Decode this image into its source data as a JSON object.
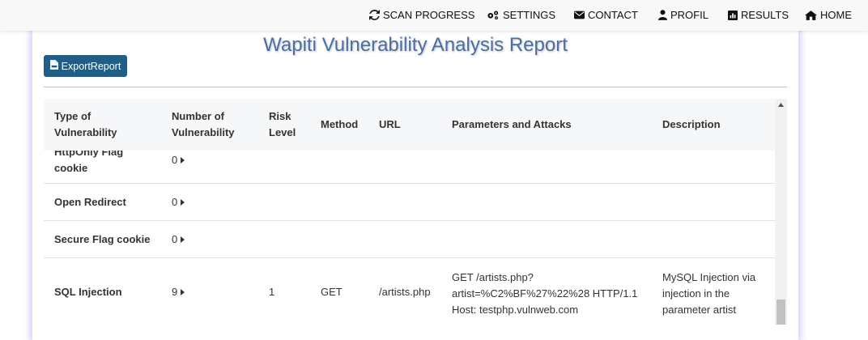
{
  "navbar": {
    "items": [
      {
        "label": "SCAN PROGRESS",
        "icon": "refresh-icon"
      },
      {
        "label": "SETTINGS",
        "icon": "gears-icon"
      },
      {
        "label": "CONTACT",
        "icon": "envelope-icon"
      },
      {
        "label": "PROFIL",
        "icon": "user-icon"
      },
      {
        "label": "RESULTS",
        "icon": "bar-chart-icon"
      },
      {
        "label": "HOME",
        "icon": "home-icon"
      }
    ]
  },
  "report": {
    "title": "Wapiti Vulnerability Analysis Report",
    "export_label": "ExportReport"
  },
  "table": {
    "headers": {
      "type_line1": "Type of",
      "type_line2": "Vulnerability",
      "count_line1": "Number of",
      "count_line2": "Vulnerability",
      "risk_line1": "Risk",
      "risk_line2": "Level",
      "method": "Method",
      "url": "URL",
      "params": "Parameters and Attacks",
      "description": "Description"
    },
    "rows": [
      {
        "type_line1": "HttpOnly Flag",
        "type_line2": "cookie",
        "count": "0"
      },
      {
        "type": "Open Redirect",
        "count": "0"
      },
      {
        "type": "Secure Flag cookie",
        "count": "0"
      },
      {
        "type": "SQL Injection",
        "count": "9",
        "risk": "1",
        "method": "GET",
        "url": "/artists.php",
        "params_line1": "GET /artists.php?",
        "params_line2": "artist=%C2%BF%27%22%28 HTTP/1.1",
        "params_line3": "Host: testphp.vulnweb.com",
        "desc_line1": "MySQL Injection via",
        "desc_line2": "injection in the",
        "desc_line3": "parameter artist"
      }
    ]
  },
  "colors": {
    "title": "#4a6fa5",
    "export_button": "#1f5f86",
    "header_bg": "#f6f7f9"
  }
}
